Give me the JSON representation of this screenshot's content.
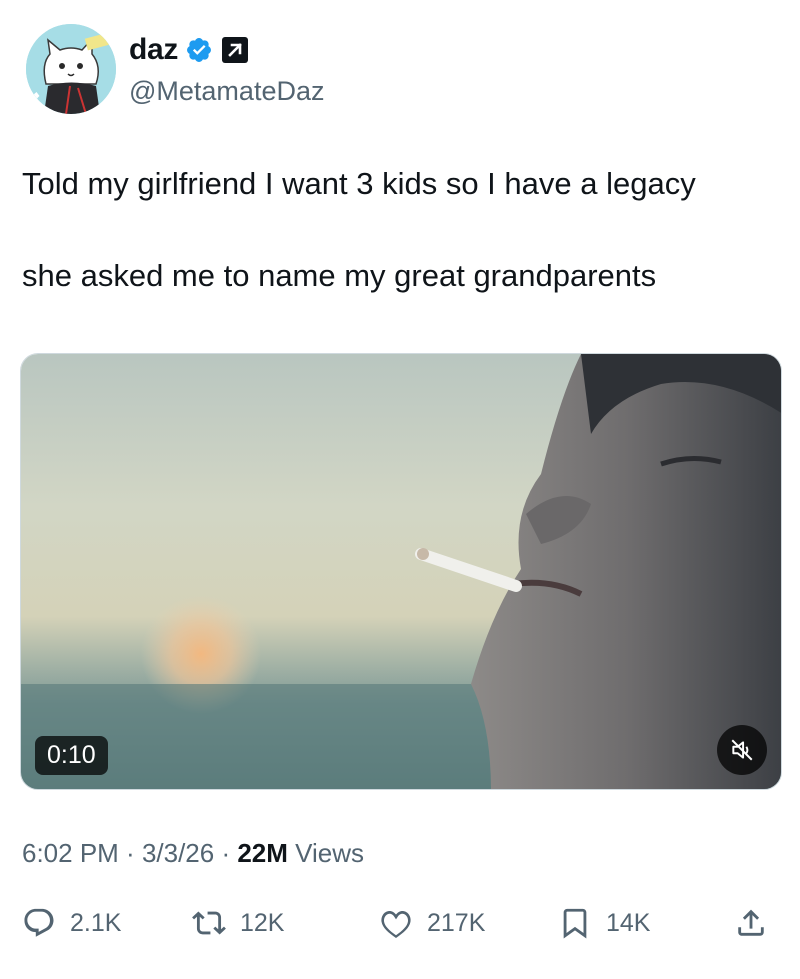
{
  "author": {
    "display_name": "daz",
    "handle": "@MetamateDaz",
    "avatar_icon": "cat-avatar",
    "verified_icon": "verified-badge-icon",
    "affiliate_icon": "arrow-up-right-icon"
  },
  "tweet": {
    "line1": "Told my girlfriend I want 3 kids so I have a legacy",
    "line2": "she asked me to name my great grandparents"
  },
  "media": {
    "duration": "0:10",
    "mute_icon": "speaker-muted-icon"
  },
  "meta": {
    "time": "6:02 PM",
    "separator": " · ",
    "date": "3/3/26",
    "views_count": "22M",
    "views_label": "Views"
  },
  "actions": {
    "replies": "2.1K",
    "reposts": "12K",
    "likes": "217K",
    "bookmarks": "14K"
  },
  "colors": {
    "verified": "#1d9bf0",
    "secondary_text": "#536471",
    "primary_text": "#0f1419"
  }
}
